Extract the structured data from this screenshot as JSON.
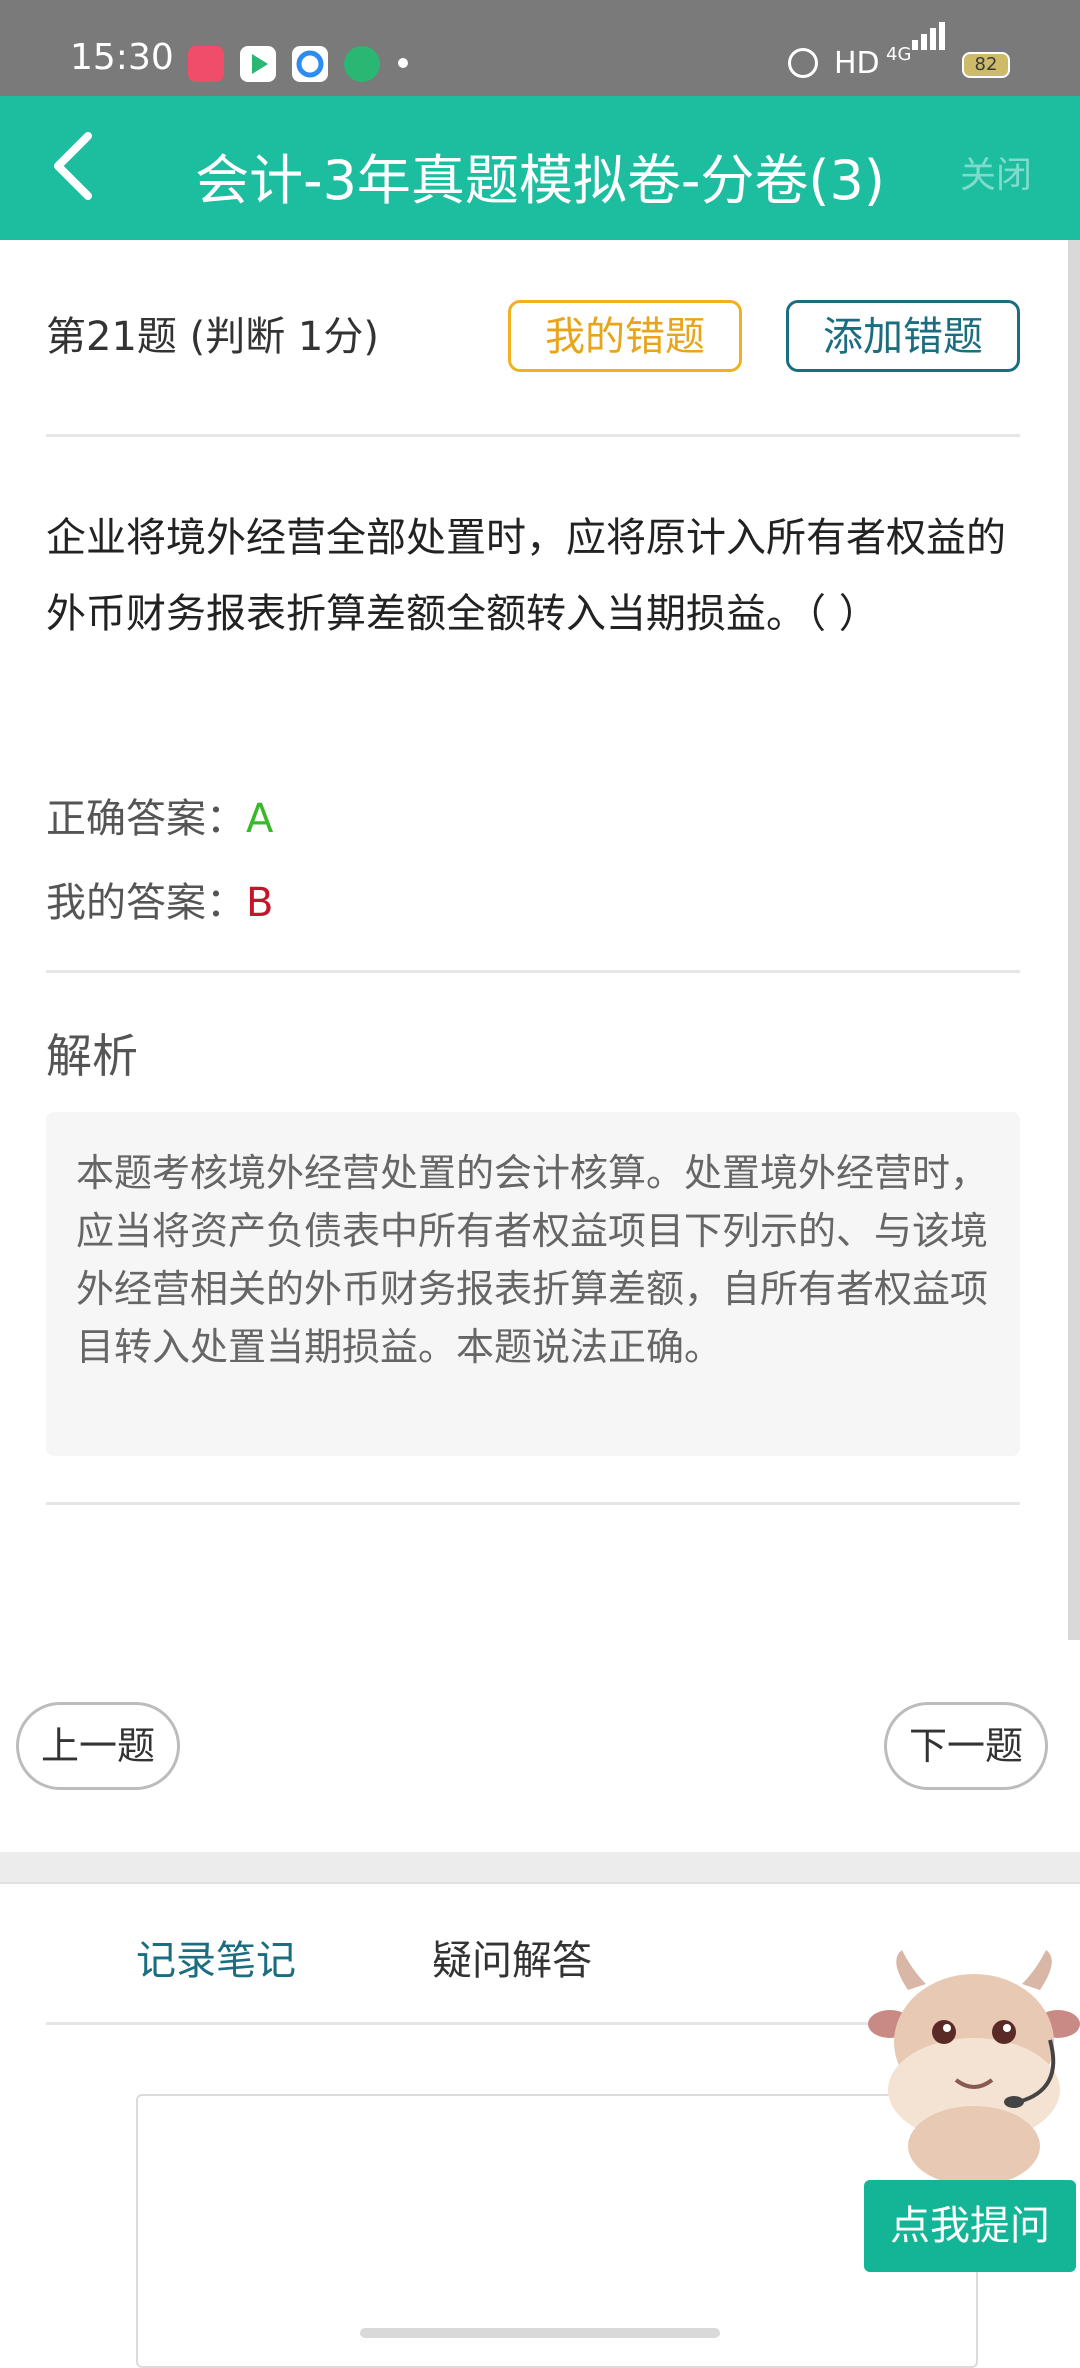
{
  "status_bar": {
    "time": "15:30",
    "hd": "HD",
    "network": "4G",
    "battery": "82",
    "app_icons": [
      "video-app-icon",
      "play-app-icon",
      "browser-app-icon",
      "education-app-icon"
    ]
  },
  "nav": {
    "title": "会计-3年真题模拟卷-分卷(3)",
    "close_label": "关闭"
  },
  "question": {
    "number_label": "第21题 (判断  1分)",
    "my_wrong_label": "我的错题",
    "add_wrong_label": "添加错题",
    "text": "企业将境外经营全部处置时，应将原计入所有者权益的外币财务报表折算差额全额转入当期损益。（   ）"
  },
  "answers": {
    "correct_label": "正确答案：",
    "correct_value": "A",
    "mine_label": "我的答案：",
    "mine_value": "B"
  },
  "analysis": {
    "heading": "解析",
    "text": "本题考核境外经营处置的会计核算。处置境外经营时，应当将资产负债表中所有者权益项目下列示的、与该境外经营相关的外币财务报表折算差额，自所有者权益项目转入处置当期损益。本题说法正确。"
  },
  "pager": {
    "prev_label": "上一题",
    "next_label": "下一题"
  },
  "bottom_tabs": {
    "notes_label": "记录笔记",
    "qa_label": "疑问解答"
  },
  "assistant": {
    "ask_label": "点我提问"
  },
  "colors": {
    "primary": "#1dbd9f",
    "correct": "#39b82a",
    "wrong": "#c4162a",
    "accent_orange": "#e8a41a",
    "accent_teal": "#1b6d80"
  }
}
